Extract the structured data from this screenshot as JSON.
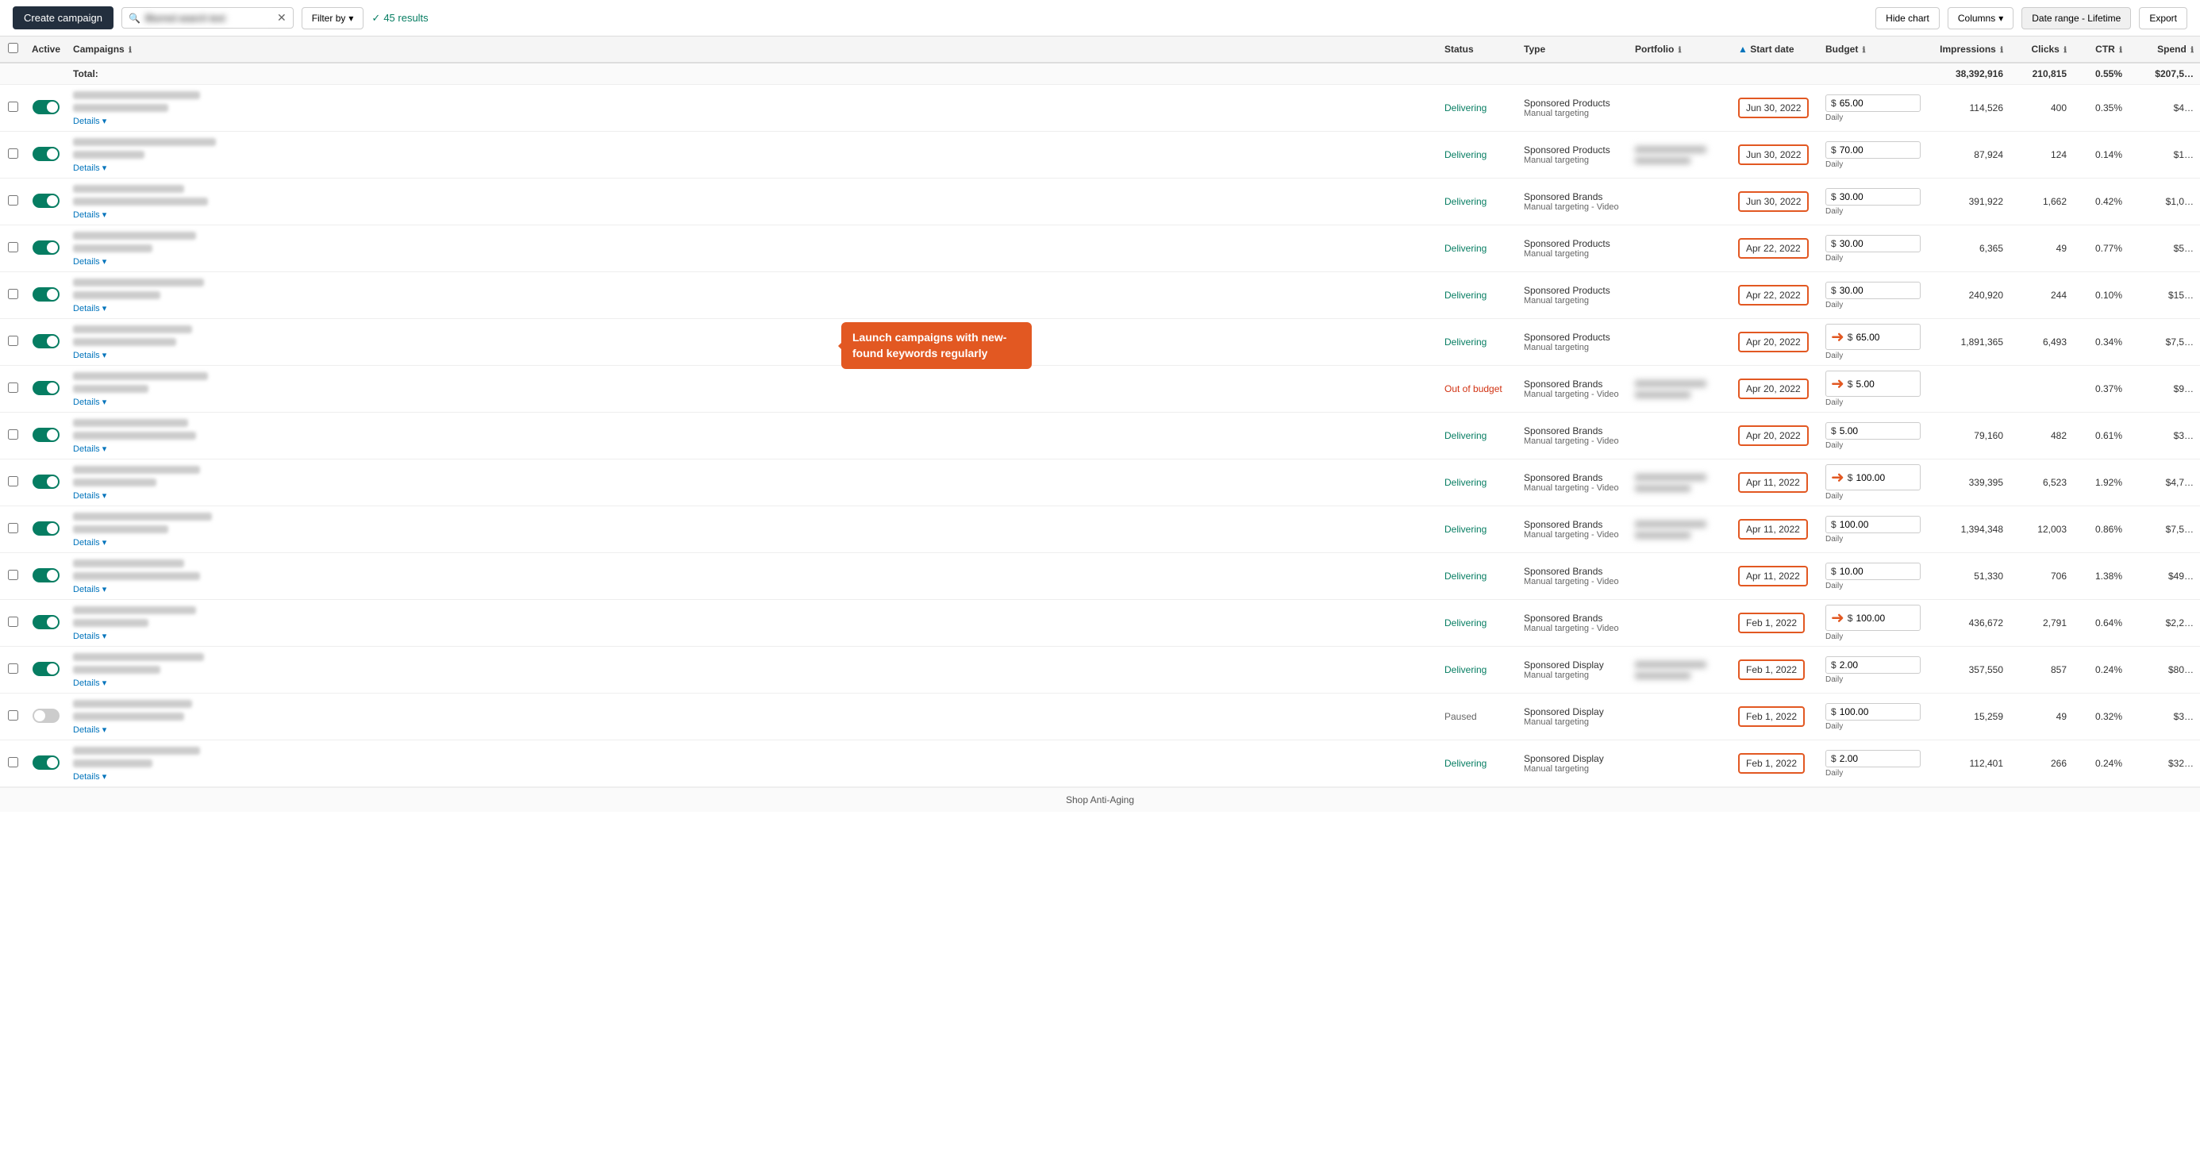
{
  "topbar": {
    "create_campaign_label": "Create campaign",
    "search_placeholder": "Search",
    "search_value": "Blurred text",
    "filter_label": "Filter by",
    "results_label": "45 results",
    "hide_chart_label": "Hide chart",
    "columns_label": "Columns",
    "date_range_label": "Date range - Lifetime",
    "export_label": "Export"
  },
  "table": {
    "headers": {
      "active": "Active",
      "campaigns": "Campaigns",
      "status": "Status",
      "type": "Type",
      "portfolio": "Portfolio",
      "start_date": "Start date",
      "budget": "Budget",
      "impressions": "Impressions",
      "clicks": "Clicks",
      "ctr": "CTR",
      "spend": "Spend"
    },
    "total_row": {
      "label": "Total:",
      "impressions": "38,392,916",
      "clicks": "210,815",
      "ctr": "0.55%",
      "spend": "$207,5…"
    },
    "rows": [
      {
        "id": 1,
        "active": true,
        "status": "Delivering",
        "status_class": "delivering",
        "type": "Sponsored Products",
        "type_sub": "Manual targeting",
        "portfolio": "",
        "start_date": "Jun 30, 2022",
        "start_date_highlight": true,
        "budget": "65.00",
        "budget_label": "Daily",
        "impressions": "114,526",
        "clicks": "400",
        "ctr": "0.35%",
        "spend": "$4…"
      },
      {
        "id": 2,
        "active": true,
        "status": "Delivering",
        "status_class": "delivering",
        "type": "Sponsored Products",
        "type_sub": "Manual targeting",
        "portfolio": "blurred",
        "start_date": "Jun 30, 2022",
        "start_date_highlight": true,
        "budget": "70.00",
        "budget_label": "Daily",
        "impressions": "87,924",
        "clicks": "124",
        "ctr": "0.14%",
        "spend": "$1…"
      },
      {
        "id": 3,
        "active": true,
        "status": "Delivering",
        "status_class": "delivering",
        "type": "Sponsored Brands",
        "type_sub": "Manual targeting - Video",
        "portfolio": "",
        "start_date": "Jun 30, 2022",
        "start_date_highlight": true,
        "budget": "30.00",
        "budget_label": "Daily",
        "impressions": "391,922",
        "clicks": "1,662",
        "ctr": "0.42%",
        "spend": "$1,0…"
      },
      {
        "id": 4,
        "active": true,
        "status": "Delivering",
        "status_class": "delivering",
        "type": "Sponsored Products",
        "type_sub": "Manual targeting",
        "portfolio": "",
        "start_date": "Apr 22, 2022",
        "start_date_highlight": true,
        "budget": "30.00",
        "budget_label": "Daily",
        "impressions": "6,365",
        "clicks": "49",
        "ctr": "0.77%",
        "spend": "$5…"
      },
      {
        "id": 5,
        "active": true,
        "status": "Delivering",
        "status_class": "delivering",
        "type": "Sponsored Products",
        "type_sub": "Manual targeting",
        "portfolio": "",
        "start_date": "Apr 22, 2022",
        "start_date_highlight": true,
        "budget": "30.00",
        "budget_label": "Daily",
        "impressions": "240,920",
        "clicks": "244",
        "ctr": "0.10%",
        "spend": "$15…"
      },
      {
        "id": 6,
        "active": true,
        "status": "Delivering",
        "status_class": "delivering",
        "type": "Sponsored Products",
        "type_sub": "Manual targeting",
        "portfolio": "",
        "start_date": "Apr 20, 2022",
        "start_date_highlight": true,
        "budget": "65.00",
        "budget_label": "Daily",
        "impressions": "1,891,365",
        "clicks": "6,493",
        "ctr": "0.34%",
        "spend": "$7,5…"
      },
      {
        "id": 7,
        "active": true,
        "status": "Out of budget",
        "status_class": "outofbudget",
        "type": "Sponsored Brands",
        "type_sub": "Manual targeting - Video",
        "portfolio": "blurred",
        "start_date": "Apr 20, 2022",
        "start_date_highlight": true,
        "budget": "5.00",
        "budget_label": "Daily",
        "impressions": "",
        "clicks": "",
        "ctr": "0.37%",
        "spend": "$9…"
      },
      {
        "id": 8,
        "active": true,
        "status": "Delivering",
        "status_class": "delivering",
        "type": "Sponsored Brands",
        "type_sub": "Manual targeting - Video",
        "portfolio": "",
        "start_date": "Apr 20, 2022",
        "start_date_highlight": true,
        "budget": "5.00",
        "budget_label": "Daily",
        "impressions": "79,160",
        "clicks": "482",
        "ctr": "0.61%",
        "spend": "$3…"
      },
      {
        "id": 9,
        "active": true,
        "status": "Delivering",
        "status_class": "delivering",
        "type": "Sponsored Brands",
        "type_sub": "Manual targeting - Video",
        "portfolio": "blurred",
        "start_date": "Apr 11, 2022",
        "start_date_highlight": true,
        "budget": "100.00",
        "budget_label": "Daily",
        "impressions": "339,395",
        "clicks": "6,523",
        "ctr": "1.92%",
        "spend": "$4,7…"
      },
      {
        "id": 10,
        "active": true,
        "status": "Delivering",
        "status_class": "delivering",
        "type": "Sponsored Brands",
        "type_sub": "Manual targeting - Video",
        "portfolio": "blurred",
        "start_date": "Apr 11, 2022",
        "start_date_highlight": true,
        "budget": "100.00",
        "budget_label": "Daily",
        "impressions": "1,394,348",
        "clicks": "12,003",
        "ctr": "0.86%",
        "spend": "$7,5…"
      },
      {
        "id": 11,
        "active": true,
        "status": "Delivering",
        "status_class": "delivering",
        "type": "Sponsored Brands",
        "type_sub": "Manual targeting - Video",
        "portfolio": "",
        "start_date": "Apr 11, 2022",
        "start_date_highlight": true,
        "budget": "10.00",
        "budget_label": "Daily",
        "impressions": "51,330",
        "clicks": "706",
        "ctr": "1.38%",
        "spend": "$49…"
      },
      {
        "id": 12,
        "active": true,
        "status": "Delivering",
        "status_class": "delivering",
        "type": "Sponsored Brands",
        "type_sub": "Manual targeting - Video",
        "portfolio": "",
        "start_date": "Feb 1, 2022",
        "start_date_highlight": true,
        "budget": "100.00",
        "budget_label": "Daily",
        "impressions": "436,672",
        "clicks": "2,791",
        "ctr": "0.64%",
        "spend": "$2,2…"
      },
      {
        "id": 13,
        "active": true,
        "status": "Delivering",
        "status_class": "delivering",
        "type": "Sponsored Display",
        "type_sub": "Manual targeting",
        "portfolio": "blurred",
        "start_date": "Feb 1, 2022",
        "start_date_highlight": true,
        "budget": "2.00",
        "budget_label": "Daily",
        "impressions": "357,550",
        "clicks": "857",
        "ctr": "0.24%",
        "spend": "$80…"
      },
      {
        "id": 14,
        "active": false,
        "status": "Paused",
        "status_class": "paused",
        "type": "Sponsored Display",
        "type_sub": "Manual targeting",
        "portfolio": "",
        "start_date": "Feb 1, 2022",
        "start_date_highlight": true,
        "budget": "100.00",
        "budget_label": "Daily",
        "impressions": "15,259",
        "clicks": "49",
        "ctr": "0.32%",
        "spend": "$3…"
      },
      {
        "id": 15,
        "active": true,
        "status": "Delivering",
        "status_class": "delivering",
        "type": "Sponsored Display",
        "type_sub": "Manual targeting",
        "portfolio": "",
        "start_date": "Feb 1, 2022",
        "start_date_highlight": true,
        "budget": "2.00",
        "budget_label": "Daily",
        "impressions": "112,401",
        "clicks": "266",
        "ctr": "0.24%",
        "spend": "$32…"
      }
    ]
  },
  "callout": {
    "text": "Launch campaigns with new-found keywords regularly"
  },
  "details_label": "Details",
  "info_icon": "ℹ",
  "chevron_down": "▾",
  "check_icon": "✓"
}
